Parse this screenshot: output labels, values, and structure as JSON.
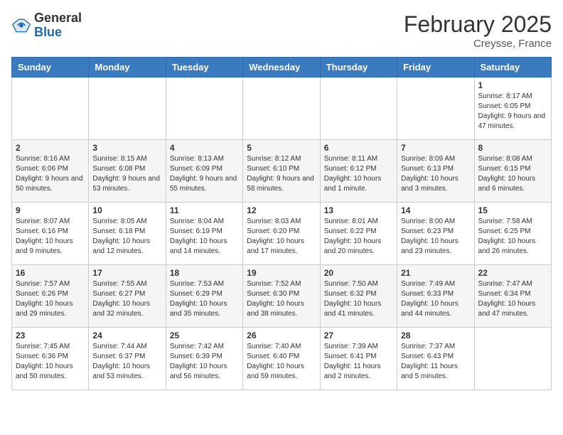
{
  "header": {
    "logo_general": "General",
    "logo_blue": "Blue",
    "month_title": "February 2025",
    "location": "Creysse, France"
  },
  "calendar": {
    "columns": [
      "Sunday",
      "Monday",
      "Tuesday",
      "Wednesday",
      "Thursday",
      "Friday",
      "Saturday"
    ],
    "weeks": [
      [
        {
          "day": "",
          "info": ""
        },
        {
          "day": "",
          "info": ""
        },
        {
          "day": "",
          "info": ""
        },
        {
          "day": "",
          "info": ""
        },
        {
          "day": "",
          "info": ""
        },
        {
          "day": "",
          "info": ""
        },
        {
          "day": "1",
          "info": "Sunrise: 8:17 AM\nSunset: 6:05 PM\nDaylight: 9 hours and 47 minutes."
        }
      ],
      [
        {
          "day": "2",
          "info": "Sunrise: 8:16 AM\nSunset: 6:06 PM\nDaylight: 9 hours and 50 minutes."
        },
        {
          "day": "3",
          "info": "Sunrise: 8:15 AM\nSunset: 6:08 PM\nDaylight: 9 hours and 53 minutes."
        },
        {
          "day": "4",
          "info": "Sunrise: 8:13 AM\nSunset: 6:09 PM\nDaylight: 9 hours and 55 minutes."
        },
        {
          "day": "5",
          "info": "Sunrise: 8:12 AM\nSunset: 6:10 PM\nDaylight: 9 hours and 58 minutes."
        },
        {
          "day": "6",
          "info": "Sunrise: 8:11 AM\nSunset: 6:12 PM\nDaylight: 10 hours and 1 minute."
        },
        {
          "day": "7",
          "info": "Sunrise: 8:09 AM\nSunset: 6:13 PM\nDaylight: 10 hours and 3 minutes."
        },
        {
          "day": "8",
          "info": "Sunrise: 8:08 AM\nSunset: 6:15 PM\nDaylight: 10 hours and 6 minutes."
        }
      ],
      [
        {
          "day": "9",
          "info": "Sunrise: 8:07 AM\nSunset: 6:16 PM\nDaylight: 10 hours and 9 minutes."
        },
        {
          "day": "10",
          "info": "Sunrise: 8:05 AM\nSunset: 6:18 PM\nDaylight: 10 hours and 12 minutes."
        },
        {
          "day": "11",
          "info": "Sunrise: 8:04 AM\nSunset: 6:19 PM\nDaylight: 10 hours and 14 minutes."
        },
        {
          "day": "12",
          "info": "Sunrise: 8:03 AM\nSunset: 6:20 PM\nDaylight: 10 hours and 17 minutes."
        },
        {
          "day": "13",
          "info": "Sunrise: 8:01 AM\nSunset: 6:22 PM\nDaylight: 10 hours and 20 minutes."
        },
        {
          "day": "14",
          "info": "Sunrise: 8:00 AM\nSunset: 6:23 PM\nDaylight: 10 hours and 23 minutes."
        },
        {
          "day": "15",
          "info": "Sunrise: 7:58 AM\nSunset: 6:25 PM\nDaylight: 10 hours and 26 minutes."
        }
      ],
      [
        {
          "day": "16",
          "info": "Sunrise: 7:57 AM\nSunset: 6:26 PM\nDaylight: 10 hours and 29 minutes."
        },
        {
          "day": "17",
          "info": "Sunrise: 7:55 AM\nSunset: 6:27 PM\nDaylight: 10 hours and 32 minutes."
        },
        {
          "day": "18",
          "info": "Sunrise: 7:53 AM\nSunset: 6:29 PM\nDaylight: 10 hours and 35 minutes."
        },
        {
          "day": "19",
          "info": "Sunrise: 7:52 AM\nSunset: 6:30 PM\nDaylight: 10 hours and 38 minutes."
        },
        {
          "day": "20",
          "info": "Sunrise: 7:50 AM\nSunset: 6:32 PM\nDaylight: 10 hours and 41 minutes."
        },
        {
          "day": "21",
          "info": "Sunrise: 7:49 AM\nSunset: 6:33 PM\nDaylight: 10 hours and 44 minutes."
        },
        {
          "day": "22",
          "info": "Sunrise: 7:47 AM\nSunset: 6:34 PM\nDaylight: 10 hours and 47 minutes."
        }
      ],
      [
        {
          "day": "23",
          "info": "Sunrise: 7:45 AM\nSunset: 6:36 PM\nDaylight: 10 hours and 50 minutes."
        },
        {
          "day": "24",
          "info": "Sunrise: 7:44 AM\nSunset: 6:37 PM\nDaylight: 10 hours and 53 minutes."
        },
        {
          "day": "25",
          "info": "Sunrise: 7:42 AM\nSunset: 6:39 PM\nDaylight: 10 hours and 56 minutes."
        },
        {
          "day": "26",
          "info": "Sunrise: 7:40 AM\nSunset: 6:40 PM\nDaylight: 10 hours and 59 minutes."
        },
        {
          "day": "27",
          "info": "Sunrise: 7:39 AM\nSunset: 6:41 PM\nDaylight: 11 hours and 2 minutes."
        },
        {
          "day": "28",
          "info": "Sunrise: 7:37 AM\nSunset: 6:43 PM\nDaylight: 11 hours and 5 minutes."
        },
        {
          "day": "",
          "info": ""
        }
      ]
    ]
  }
}
